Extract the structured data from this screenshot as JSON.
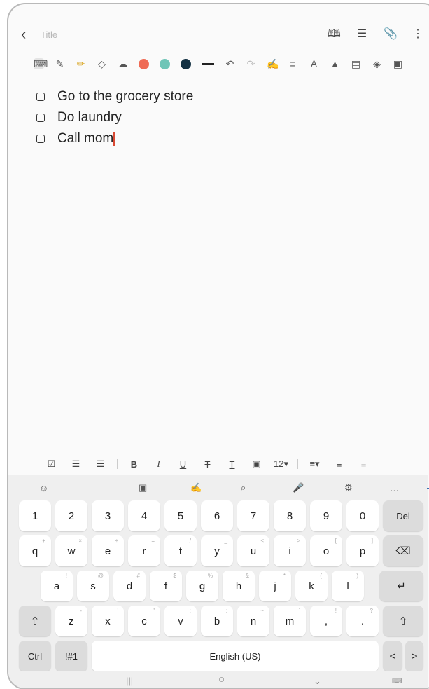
{
  "topbar": {
    "back_icon": "chevron-left",
    "title_placeholder": "Title",
    "icons": [
      "book-icon",
      "list-view-icon",
      "attach-icon",
      "more-icon"
    ]
  },
  "pen_toolbar": {
    "tools": [
      "keyboard-mode",
      "pen",
      "highlighter",
      "eraser",
      "lasso"
    ],
    "colors": [
      "#ef6b55",
      "#6fc5b7",
      "#133143"
    ],
    "actions": [
      "undo",
      "redo",
      "handwriting-convert",
      "text-style",
      "font-size",
      "shape",
      "insert",
      "pen-settings",
      "page-settings"
    ]
  },
  "notes": {
    "items": [
      {
        "text": "Go to the grocery store"
      },
      {
        "text": "Do laundry"
      },
      {
        "text": "Call mom"
      }
    ]
  },
  "format_toolbar": {
    "font_size": "12"
  },
  "keyboard": {
    "suggestion_icons": [
      "emoji",
      "clipboard",
      "sticker",
      "handwriting",
      "search",
      "voice",
      "settings",
      "more"
    ],
    "more_label": "…",
    "row1": [
      "1",
      "2",
      "3",
      "4",
      "5",
      "6",
      "7",
      "8",
      "9",
      "0",
      "Del"
    ],
    "row2": [
      "q",
      "w",
      "e",
      "r",
      "t",
      "y",
      "u",
      "i",
      "o",
      "p"
    ],
    "row2_subs": [
      "+",
      "×",
      "÷",
      "=",
      "/",
      "_",
      "<",
      ">",
      "[",
      "]"
    ],
    "row3": [
      "a",
      "s",
      "d",
      "f",
      "g",
      "h",
      "j",
      "k",
      "l"
    ],
    "row3_subs": [
      "!",
      "@",
      "#",
      "$",
      "%",
      "&",
      "*",
      "(",
      ")"
    ],
    "row4": [
      "z",
      "x",
      "c",
      "v",
      "b",
      "n",
      "m",
      ",",
      "."
    ],
    "row4_subs": [
      "-",
      "'",
      "\"",
      ":",
      ";",
      "~",
      "`",
      "!",
      "?"
    ],
    "ctrl": "Ctrl",
    "symbols": "!#1",
    "space": "English (US)",
    "left_arrow": "<",
    "right_arrow": ">"
  },
  "navbar": {
    "recent": "|||",
    "home": "○",
    "back": "⌄"
  }
}
